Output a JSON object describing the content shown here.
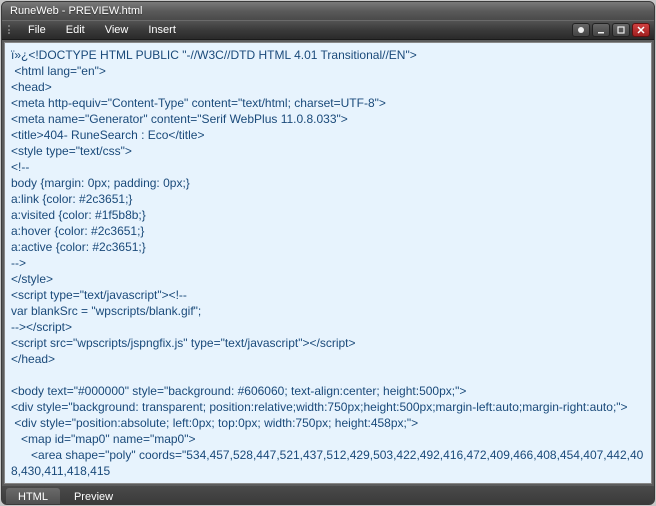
{
  "window": {
    "title": "RuneWeb - PREVIEW.html"
  },
  "menu": {
    "file": "File",
    "edit": "Edit",
    "view": "View",
    "insert": "Insert"
  },
  "editor": {
    "content": "ï»¿<!DOCTYPE HTML PUBLIC \"-//W3C//DTD HTML 4.01 Transitional//EN\">\n <html lang=\"en\">\n<head>\n<meta http-equiv=\"Content-Type\" content=\"text/html; charset=UTF-8\">\n<meta name=\"Generator\" content=\"Serif WebPlus 11.0.8.033\">\n<title>404- RuneSearch : Eco</title>\n<style type=\"text/css\">\n<!--\nbody {margin: 0px; padding: 0px;}\na:link {color: #2c3651;}\na:visited {color: #1f5b8b;}\na:hover {color: #2c3651;}\na:active {color: #2c3651;}\n-->\n</style>\n<script type=\"text/javascript\"><!--\nvar blankSrc = \"wpscripts/blank.gif\";\n--></script>\n<script src=\"wpscripts/jspngfix.js\" type=\"text/javascript\"></script>\n</head>\n\n<body text=\"#000000\" style=\"background: #606060; text-align:center; height:500px;\">\n<div style=\"background: transparent; position:relative;width:750px;height:500px;margin-left:auto;margin-right:auto;\">\n <div style=\"position:absolute; left:0px; top:0px; width:750px; height:458px;\">\n   <map id=\"map0\" name=\"map0\">\n      <area shape=\"poly\" coords=\"534,457,528,447,521,437,512,429,503,422,492,416,472,409,466,408,454,407,442,408,430,411,418,415"
  },
  "tabs": {
    "html": "HTML",
    "preview": "Preview"
  }
}
